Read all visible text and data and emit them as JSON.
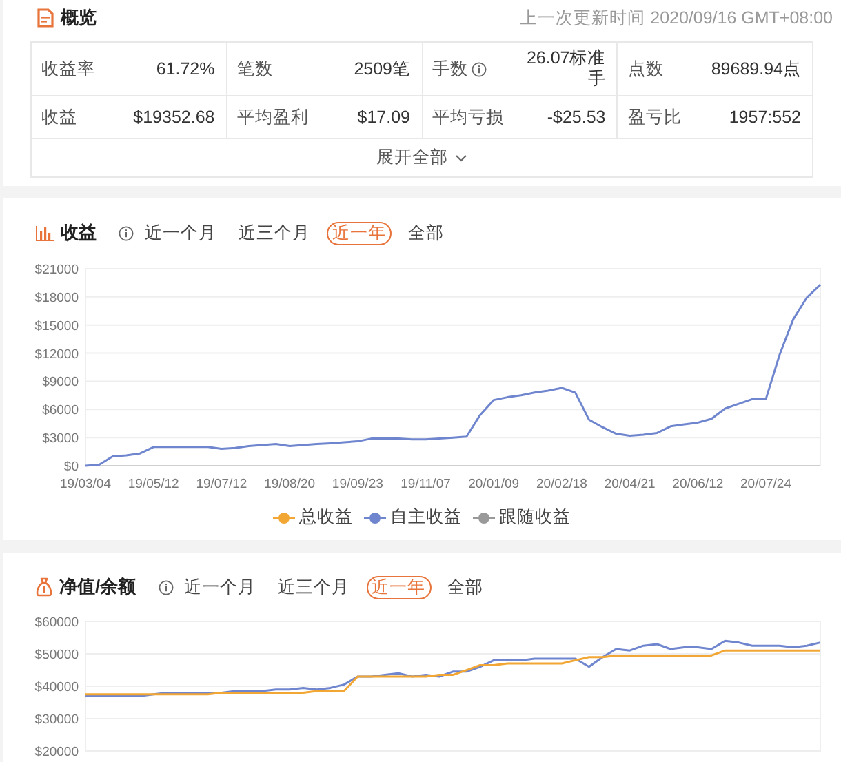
{
  "overview": {
    "title": "概览",
    "updated": "上一次更新时间 2020/09/16 GMT+08:00",
    "stats": [
      [
        {
          "label": "收益率",
          "value": "61.72%",
          "info": false
        },
        {
          "label": "笔数",
          "value": "2509笔",
          "info": false
        },
        {
          "label": "手数",
          "value": "26.07标准手",
          "info": true
        },
        {
          "label": "点数",
          "value": "89689.94点",
          "info": false
        }
      ],
      [
        {
          "label": "收益",
          "value": "$19352.68",
          "info": false
        },
        {
          "label": "平均盈利",
          "value": "$17.09",
          "info": false
        },
        {
          "label": "平均亏损",
          "value": "-$25.53",
          "info": false
        },
        {
          "label": "盈亏比",
          "value": "1957:552",
          "info": false
        }
      ]
    ],
    "expand": "展开全部"
  },
  "profit_panel": {
    "title": "收益",
    "tabs": [
      {
        "label": "近一个月",
        "selected": false
      },
      {
        "label": "近三个月",
        "selected": false
      },
      {
        "label": "近一年",
        "selected": true
      },
      {
        "label": "全部",
        "selected": false
      }
    ],
    "chart_data": {
      "type": "line",
      "grid": true,
      "ylim": [
        0,
        21000
      ],
      "categories": [
        "19/03/04",
        null,
        null,
        null,
        null,
        "19/05/12",
        null,
        null,
        null,
        null,
        "19/07/12",
        null,
        null,
        null,
        null,
        "19/08/20",
        null,
        null,
        null,
        null,
        "19/09/23",
        null,
        null,
        null,
        null,
        "19/11/07",
        null,
        null,
        null,
        null,
        "20/01/09",
        null,
        null,
        null,
        null,
        "20/02/18",
        null,
        null,
        null,
        null,
        "20/04/21",
        null,
        null,
        null,
        null,
        "20/06/12",
        null,
        null,
        null,
        null,
        "20/07/24",
        null,
        null,
        null,
        null
      ],
      "yticks": [
        {
          "value": 0,
          "label": "$0"
        },
        {
          "value": 3000,
          "label": "$3000"
        },
        {
          "value": 6000,
          "label": "$6000"
        },
        {
          "value": 9000,
          "label": "$9000"
        },
        {
          "value": 12000,
          "label": "$12000"
        },
        {
          "value": 15000,
          "label": "$15000"
        },
        {
          "value": 18000,
          "label": "$18000"
        },
        {
          "value": 21000,
          "label": "$21000"
        }
      ],
      "series": [
        {
          "color": "#6f86cf",
          "values": [
            0,
            100,
            1000,
            1100,
            1300,
            2000,
            2000,
            2000,
            2000,
            2000,
            1800,
            1900,
            2100,
            2200,
            2300,
            2100,
            2200,
            2300,
            2400,
            2500,
            2600,
            2900,
            2900,
            2900,
            2800,
            2800,
            2900,
            3000,
            3100,
            5400,
            7000,
            7300,
            7500,
            7800,
            8000,
            8300,
            7800,
            4900,
            4100,
            3400,
            3200,
            3300,
            3500,
            4200,
            4400,
            4600,
            5000,
            6100,
            6600,
            7100,
            7100,
            11800,
            15600,
            17900,
            19300
          ]
        }
      ]
    },
    "legend": [
      {
        "label": "总收益",
        "color": "#f2a734"
      },
      {
        "label": "自主收益",
        "color": "#6f86cf"
      },
      {
        "label": "跟随收益",
        "color": "#999999"
      }
    ]
  },
  "equity_panel": {
    "title": "净值/余额",
    "tabs": [
      {
        "label": "近一个月",
        "selected": false
      },
      {
        "label": "近三个月",
        "selected": false
      },
      {
        "label": "近一年",
        "selected": true
      },
      {
        "label": "全部",
        "selected": false
      }
    ],
    "chart_data": {
      "type": "line",
      "grid": true,
      "ylim": [
        20000,
        60000
      ],
      "categories": [
        null,
        null,
        null,
        null,
        null,
        null,
        null,
        null,
        null,
        null,
        null,
        null,
        null,
        null,
        null,
        null,
        null,
        null,
        null,
        null,
        null,
        null,
        null,
        null,
        null,
        null,
        null,
        null,
        null,
        null,
        null,
        null,
        null,
        null,
        null,
        null,
        null,
        null,
        null,
        null,
        null,
        null,
        null,
        null,
        null,
        null,
        null,
        null,
        null,
        null,
        null,
        null,
        null,
        null,
        null
      ],
      "yticks": [
        {
          "value": 20000,
          "label": "$20000"
        },
        {
          "value": 30000,
          "label": "$30000"
        },
        {
          "value": 40000,
          "label": "$40000"
        },
        {
          "value": 50000,
          "label": "$50000"
        },
        {
          "value": 60000,
          "label": "$60000"
        }
      ],
      "series": [
        {
          "color": "#6f86cf",
          "values": [
            37000,
            37000,
            37000,
            37000,
            37000,
            37500,
            38000,
            38000,
            38000,
            38000,
            38000,
            38500,
            38500,
            38500,
            39000,
            39000,
            39500,
            39000,
            39500,
            40500,
            43000,
            43000,
            43500,
            44000,
            43000,
            43500,
            43000,
            44500,
            44500,
            46000,
            48000,
            48000,
            48000,
            48500,
            48500,
            48500,
            48500,
            46000,
            49000,
            51500,
            51000,
            52500,
            53000,
            51500,
            52000,
            52000,
            51500,
            54000,
            53500,
            52500,
            52500,
            52500,
            52000,
            52500,
            53500
          ]
        },
        {
          "color": "#f2a734",
          "values": [
            37500,
            37500,
            37500,
            37500,
            37500,
            37500,
            37500,
            37500,
            37500,
            37500,
            38000,
            38000,
            38000,
            38000,
            38000,
            38000,
            38000,
            38500,
            38500,
            38500,
            43000,
            43000,
            43000,
            43000,
            43000,
            43000,
            43500,
            43500,
            45000,
            46500,
            46500,
            47000,
            47000,
            47000,
            47000,
            47000,
            48000,
            49000,
            49000,
            49500,
            49500,
            49500,
            49500,
            49500,
            49500,
            49500,
            49500,
            51000,
            51000,
            51000,
            51000,
            51000,
            51000,
            51000,
            51000
          ]
        }
      ]
    }
  }
}
